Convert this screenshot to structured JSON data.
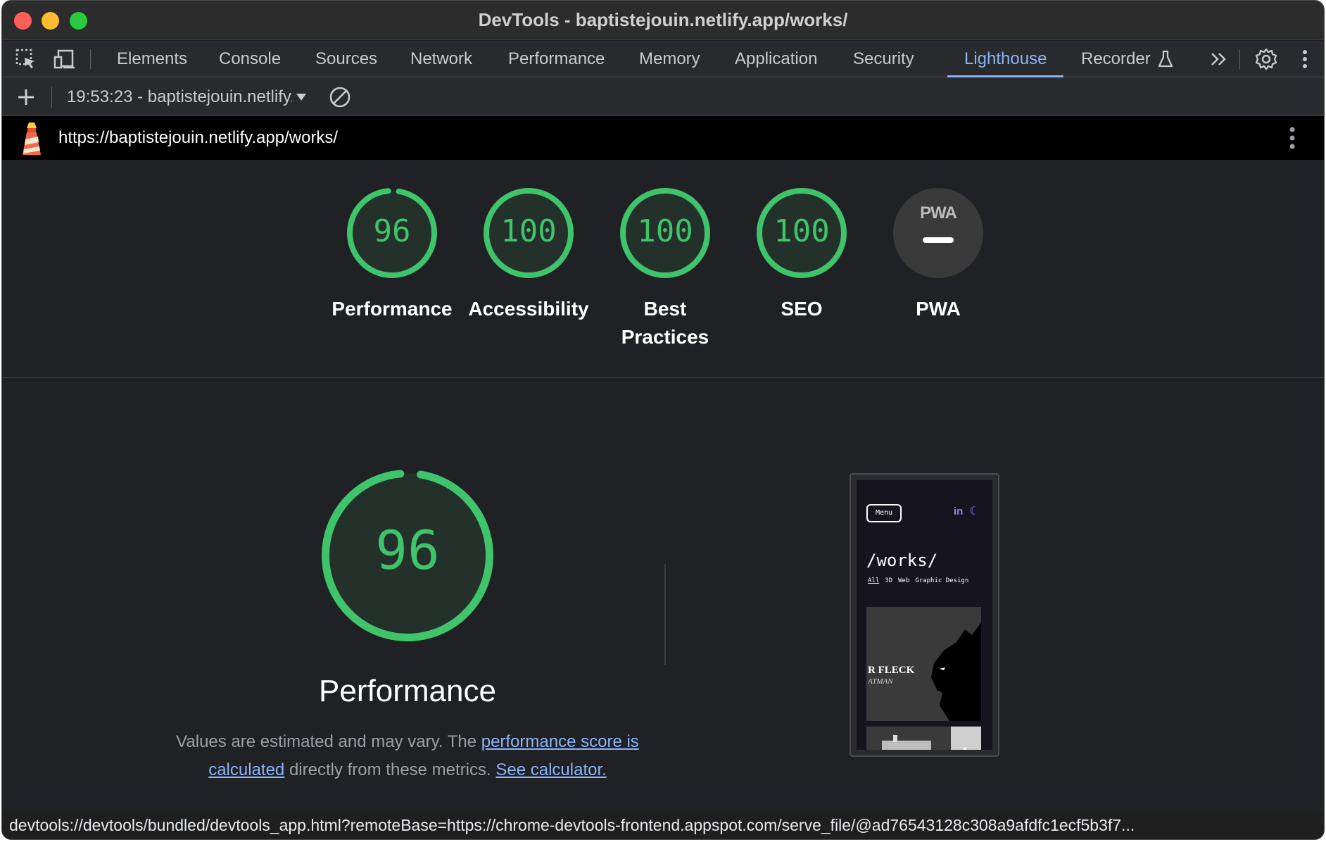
{
  "window": {
    "title": "DevTools - baptistejouin.netlify.app/works/"
  },
  "tabs": [
    {
      "label": "Elements"
    },
    {
      "label": "Console"
    },
    {
      "label": "Sources"
    },
    {
      "label": "Network"
    },
    {
      "label": "Performance"
    },
    {
      "label": "Memory"
    },
    {
      "label": "Application"
    },
    {
      "label": "Security"
    },
    {
      "label": "Lighthouse",
      "active": true
    },
    {
      "label": "Recorder"
    }
  ],
  "report": {
    "selected": "19:53:23 - baptistejouin.netlify.app"
  },
  "url": "https://baptistejouin.netlify.app/works/",
  "scores": [
    {
      "label": "Performance",
      "value": "96",
      "fraction": 0.96
    },
    {
      "label": "Accessibility",
      "value": "100",
      "fraction": 1.0
    },
    {
      "label": "Best Practices",
      "value": "100",
      "fraction": 1.0
    },
    {
      "label": "SEO",
      "value": "100",
      "fraction": 1.0
    },
    {
      "label": "PWA",
      "badge": "PWA"
    }
  ],
  "performance": {
    "score": "96",
    "fraction": 0.96,
    "title": "Performance",
    "desc_prefix": "Values are estimated and may vary. The ",
    "desc_link1": "performance score is calculated",
    "desc_middle": " directly from these metrics. ",
    "desc_link2": "See calculator."
  },
  "thumbnail": {
    "menu": "Menu",
    "social": "in",
    "heading": "/works/",
    "filters": [
      "All",
      "3D",
      "Web",
      "Graphic Design"
    ],
    "card_title": "R FLECK",
    "card_subtitle": "ATMAN"
  },
  "status": "devtools://devtools/bundled/devtools_app.html?remoteBase=https://chrome-devtools-frontend.appspot.com/serve_file/@ad76543128c308a9afdfc1ecf5b3f7...",
  "colors": {
    "pass": "#3fc46b",
    "accent": "#8ab4f8",
    "background": "#202124"
  }
}
